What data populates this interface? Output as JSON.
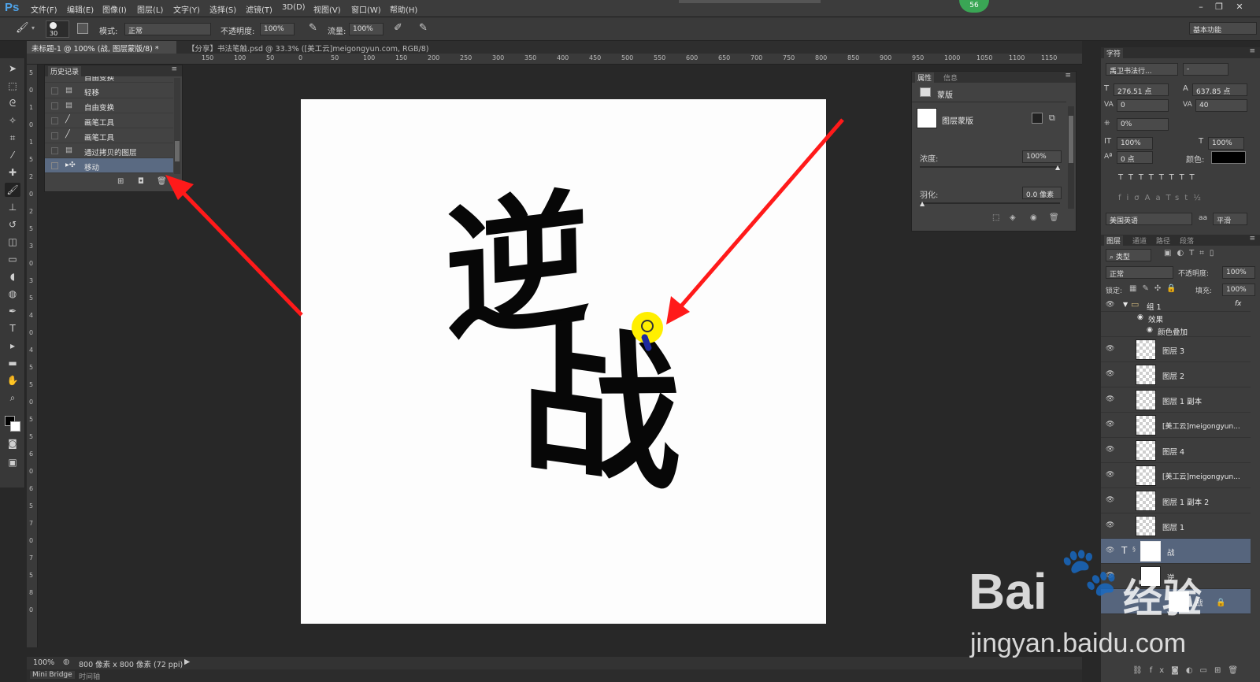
{
  "menubar": {
    "app_logo": "Ps",
    "items": [
      "文件(F)",
      "编辑(E)",
      "图像(I)",
      "图层(L)",
      "文字(Y)",
      "选择(S)",
      "滤镜(T)",
      "3D(D)",
      "视图(V)",
      "窗口(W)",
      "帮助(H)"
    ],
    "notification_count": "56"
  },
  "options": {
    "brush_size": "30",
    "mode_label": "模式:",
    "mode_value": "正常",
    "opacity_label": "不透明度:",
    "opacity_value": "100%",
    "flow_label": "流量:",
    "flow_value": "100%",
    "workspace": "基本功能"
  },
  "tabs": [
    {
      "label": "未标题-1 @ 100% (战, 图层蒙版/8) *"
    },
    {
      "label": "【分享】书法笔触.psd @ 33.3% ([美工云]meigongyun.com, RGB/8)"
    }
  ],
  "ruler_top": [
    "150",
    "100",
    "50",
    "0",
    "50",
    "100",
    "150",
    "200",
    "250",
    "300",
    "350",
    "400",
    "450",
    "500",
    "550",
    "600",
    "650",
    "700",
    "750",
    "800",
    "850",
    "900",
    "950",
    "1000",
    "1050",
    "1100",
    "1150"
  ],
  "ruler_left": [
    "5",
    "0",
    "1",
    "0",
    "1",
    "5",
    "2",
    "0",
    "2",
    "5",
    "3",
    "0",
    "3",
    "5",
    "4",
    "0",
    "4",
    "5",
    "5",
    "0",
    "5",
    "5",
    "6",
    "0",
    "6",
    "5",
    "7",
    "0",
    "7",
    "5",
    "8",
    "0"
  ],
  "history": {
    "title": "历史记录",
    "items": [
      "自由变换",
      "轻移",
      "自由变换",
      "画笔工具",
      "画笔工具",
      "通过拷贝的图层",
      "移动"
    ]
  },
  "properties": {
    "tabs": [
      "属性",
      "信息"
    ],
    "header": "蒙版",
    "mask_label": "图层蒙版",
    "density_label": "浓度:",
    "density_value": "100%",
    "feather_label": "羽化:",
    "feather_value": "0.0 像素"
  },
  "character": {
    "tab": "字符",
    "font": "禹卫书法行...",
    "font_style": "-",
    "size": "276.51 点",
    "leading": "637.85 点",
    "kerning": "0",
    "tracking": "40",
    "scale_pct": "0%",
    "vscale": "100%",
    "hscale": "100%",
    "baseline": "0 点",
    "color_label": "颜色:",
    "language": "美国英语",
    "aa_label": "aa",
    "aa_value": "平滑"
  },
  "layers_panel": {
    "tabs": [
      "图层",
      "通道",
      "路径",
      "段落"
    ],
    "filter": "类型",
    "blend": "正常",
    "opacity_label": "不透明度:",
    "opacity_value": "100%",
    "lock_label": "锁定:",
    "fill_label": "填充:",
    "fill_value": "100%",
    "group": "组 1",
    "effects": "效果",
    "effect_item": "颜色叠加",
    "layers": [
      "图层 3",
      "图层 2",
      "图层 1 副本",
      "[美工云]meigongyun...",
      "图层 4",
      "[美工云]meigongyun...",
      "图层 1 副本 2",
      "图层 1"
    ],
    "text_layer": "战",
    "layer_partial": "逆",
    "sublayer": "战"
  },
  "status": {
    "zoom": "100%",
    "doc_size": "800 像素 x 800 像素 (72 ppi)"
  },
  "bottom_tabs": [
    "Mini Bridge",
    "时间轴"
  ],
  "canvas_text": {
    "char1": "逆",
    "char2": "战"
  },
  "watermark": {
    "brand": "Bai",
    "brand2": "经验",
    "url": "jingyan.baidu.com"
  },
  "colors": {
    "arrow": "#ff1a1a",
    "highlight": "#ffef00",
    "accent_blue": "#1d2a9e"
  }
}
